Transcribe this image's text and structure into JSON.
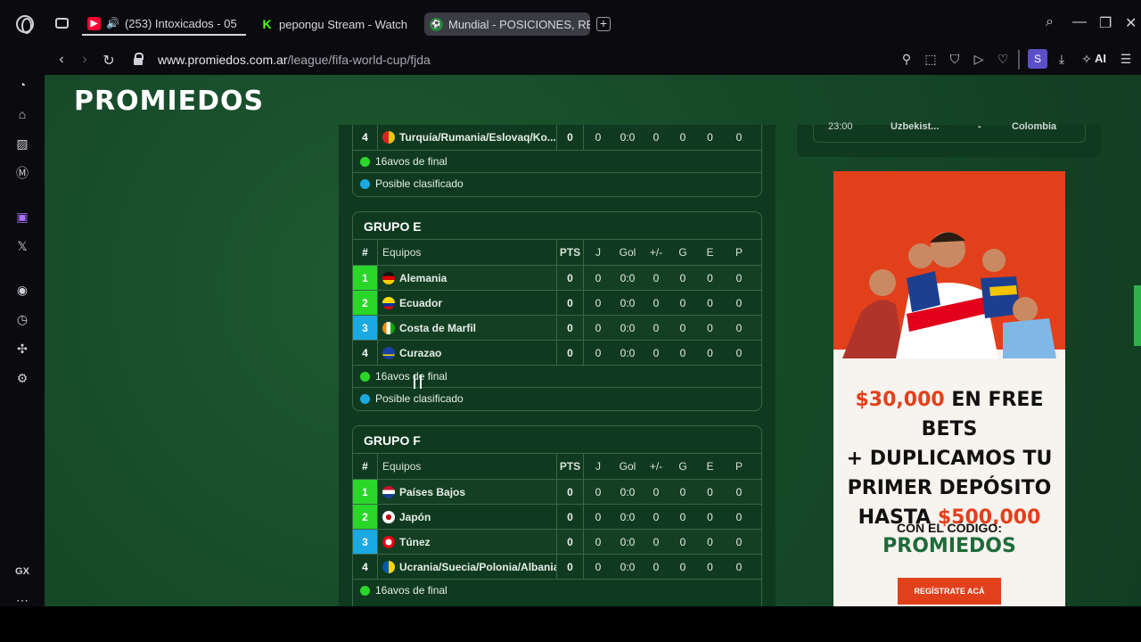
{
  "browser": {
    "tabs": [
      {
        "label": "(253) Intoxicados - 05",
        "favicon": "youtube-icon"
      },
      {
        "label": "pepongu Stream - Watch",
        "favicon": "kick-icon"
      },
      {
        "label": "Mundial - POSICIONES, RE",
        "favicon": "soccer-ball-icon"
      }
    ],
    "url_host": "www.promiedos.com.ar",
    "url_path": "/league/fifa-world-cup/fjda",
    "avatar_letter": "S",
    "ai_label": "AI",
    "sidebar_gx": "GX"
  },
  "site": {
    "logo": "PROMIEDOS"
  },
  "match_card": {
    "time": "23:00",
    "home": "Uzbekist...",
    "score": "-",
    "away": "Colombia"
  },
  "table_headers": {
    "pos": "#",
    "team": "Equipos",
    "pts": "PTS",
    "j": "J",
    "gol": "Gol",
    "diff": "+/-",
    "g": "G",
    "e": "E",
    "p": "P"
  },
  "legend": {
    "round_of_32": "16avos de final",
    "possible": "Posible clasificado"
  },
  "group_d_partial": {
    "row": {
      "pos": "4",
      "team": "Turquía/Rumania/Eslovaq/Ko...",
      "pts": "0",
      "j": "0",
      "gol": "0:0",
      "diff": "0",
      "g": "0",
      "e": "0",
      "p": "0"
    }
  },
  "group_e": {
    "title": "GRUPO E",
    "rows": [
      {
        "pos": "1",
        "team": "Alemania",
        "pts": "0",
        "j": "0",
        "gol": "0:0",
        "diff": "0",
        "g": "0",
        "e": "0",
        "p": "0"
      },
      {
        "pos": "2",
        "team": "Ecuador",
        "pts": "0",
        "j": "0",
        "gol": "0:0",
        "diff": "0",
        "g": "0",
        "e": "0",
        "p": "0"
      },
      {
        "pos": "3",
        "team": "Costa de Marfil",
        "pts": "0",
        "j": "0",
        "gol": "0:0",
        "diff": "0",
        "g": "0",
        "e": "0",
        "p": "0"
      },
      {
        "pos": "4",
        "team": "Curazao",
        "pts": "0",
        "j": "0",
        "gol": "0:0",
        "diff": "0",
        "g": "0",
        "e": "0",
        "p": "0"
      }
    ]
  },
  "group_f": {
    "title": "GRUPO F",
    "rows": [
      {
        "pos": "1",
        "team": "Países Bajos",
        "pts": "0",
        "j": "0",
        "gol": "0:0",
        "diff": "0",
        "g": "0",
        "e": "0",
        "p": "0"
      },
      {
        "pos": "2",
        "team": "Japón",
        "pts": "0",
        "j": "0",
        "gol": "0:0",
        "diff": "0",
        "g": "0",
        "e": "0",
        "p": "0"
      },
      {
        "pos": "3",
        "team": "Túnez",
        "pts": "0",
        "j": "0",
        "gol": "0:0",
        "diff": "0",
        "g": "0",
        "e": "0",
        "p": "0"
      },
      {
        "pos": "4",
        "team": "Ucrania/Suecia/Polonia/Albania",
        "pts": "0",
        "j": "0",
        "gol": "0:0",
        "diff": "0",
        "g": "0",
        "e": "0",
        "p": "0"
      }
    ]
  },
  "ad": {
    "line1_red": "$30,000",
    "line1_rest": " EN FREE BETS",
    "line2": "+ DUPLICAMOS TU",
    "line3": "PRIMER DEPÓSITO",
    "line4_prefix": "HASTA ",
    "line4_red": "$500,000",
    "code_label": "CON EL CÓDIGO:",
    "code": "PROMIEDOS",
    "button": "REGÍSTRATE ACÁ"
  },
  "colors": {
    "page_bg": "#174a29",
    "qualified": "#2bd62b",
    "possible": "#1aa9e0",
    "ad_red": "#e2401b"
  }
}
